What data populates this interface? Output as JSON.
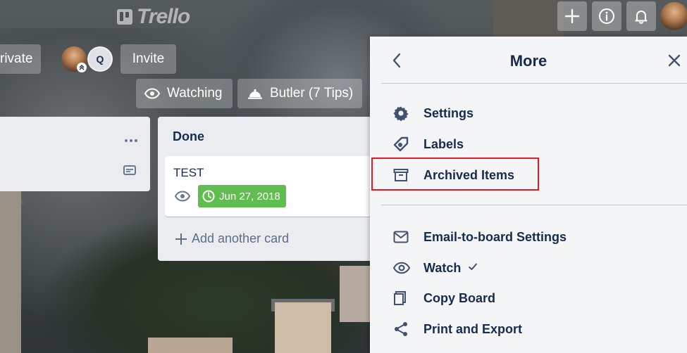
{
  "header": {
    "logo_text": "Trello",
    "add_icon": "plus-icon",
    "info_icon": "info-icon",
    "notification_icon": "bell-icon"
  },
  "board_header": {
    "visibility_label": "rivate",
    "member_initial": "Q",
    "invite_label": "Invite",
    "watching_label": "Watching",
    "butler_label": "Butler (7 Tips)"
  },
  "lists": {
    "done": {
      "title": "Done",
      "card": {
        "title": "TEST",
        "due_date": "Jun 27, 2018"
      },
      "add_card_label": "Add another card"
    }
  },
  "panel": {
    "title": "More",
    "items": [
      {
        "label": "Settings",
        "icon": "gear-icon"
      },
      {
        "label": "Labels",
        "icon": "tag-icon"
      },
      {
        "label": "Archived Items",
        "icon": "archive-icon"
      },
      {
        "label": "Email-to-board Settings",
        "icon": "envelope-icon"
      },
      {
        "label": "Watch",
        "icon": "eye-icon",
        "checked": true
      },
      {
        "label": "Copy Board",
        "icon": "copy-icon"
      },
      {
        "label": "Print and Export",
        "icon": "share-icon"
      }
    ]
  },
  "colors": {
    "due_badge": "#61bd4f",
    "highlight": "#e01b24",
    "text_primary": "#172b4d"
  }
}
